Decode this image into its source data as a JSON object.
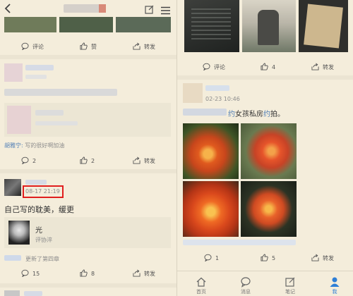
{
  "left": {
    "actions_top": [
      {
        "icon": "comment-icon",
        "label": "评论"
      },
      {
        "icon": "thumbs-up-icon",
        "label": "赞"
      },
      {
        "icon": "share-icon",
        "label": "转发"
      }
    ],
    "post2": {
      "comment_user": "胡雅宁:",
      "comment_text": "写的很好啊加油",
      "actions": [
        {
          "icon": "comment-icon",
          "label": "2"
        },
        {
          "icon": "thumbs-up-icon",
          "label": "2"
        },
        {
          "icon": "share-icon",
          "label": "转发"
        }
      ]
    },
    "post3": {
      "time": "08-17 21:19",
      "text": "自己写的耽美，缓更",
      "card_title": "光",
      "card_sub": "评协淬",
      "comment_suffix": "更新了第四章",
      "actions": [
        {
          "icon": "comment-icon",
          "label": "15"
        },
        {
          "icon": "thumbs-up-icon",
          "label": "8"
        },
        {
          "icon": "share-icon",
          "label": "转发"
        }
      ]
    },
    "highlight_color": "#e01e1e"
  },
  "right": {
    "actions_top": [
      {
        "icon": "comment-icon",
        "label": "评论"
      },
      {
        "icon": "thumbs-up-icon",
        "label": "4"
      },
      {
        "icon": "share-icon",
        "label": "转发"
      }
    ],
    "post": {
      "time": "02-23 10:46",
      "text_prefix": "约",
      "text_mid": "女孩私房",
      "text_link": "约",
      "text_suffix": "拍。",
      "actions": [
        {
          "icon": "comment-icon",
          "label": "1"
        },
        {
          "icon": "thumbs-up-icon",
          "label": "5"
        },
        {
          "icon": "share-icon",
          "label": "转发"
        }
      ]
    },
    "tabbar": [
      {
        "icon": "home-icon",
        "label": "首页",
        "active": false
      },
      {
        "icon": "message-icon",
        "label": "消息",
        "active": false
      },
      {
        "icon": "notes-icon",
        "label": "笔记",
        "active": false
      },
      {
        "icon": "profile-icon",
        "label": "我",
        "active": true
      }
    ],
    "accent": "#2f7fd6"
  }
}
